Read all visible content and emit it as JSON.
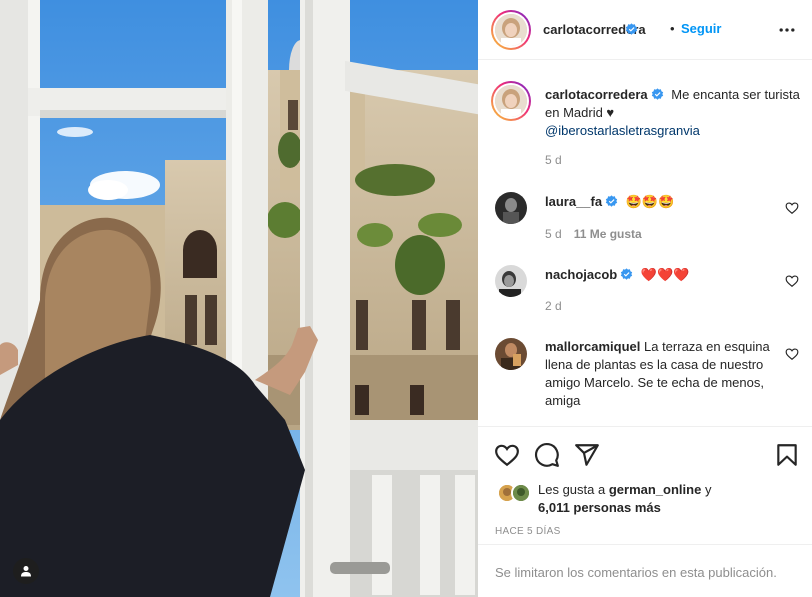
{
  "post": {
    "author": "carlotacorredera",
    "follow_label": "Seguir",
    "dot": "•"
  },
  "caption": {
    "username": "carlotacorredera",
    "text": "Me encanta ser turista en Madrid ♥",
    "mention": "@iberostarlasletrasgranvia",
    "time": "5 d"
  },
  "comments": [
    {
      "username": "laura__fa",
      "verified": true,
      "text": "🤩🤩🤩",
      "time": "5 d",
      "likes": "11 Me gusta"
    },
    {
      "username": "nachojacob",
      "verified": true,
      "text": "❤️❤️❤️",
      "time": "2 d"
    },
    {
      "username": "mallorcamiquel",
      "verified": false,
      "text": "La terraza en esquina llena de plantas es la casa de nuestro amigo Marcelo. Se te echa de menos, amiga"
    }
  ],
  "likes": {
    "prefix": "Les gusta a",
    "user": "german_online",
    "connector": "y",
    "count": "6,011 personas más"
  },
  "date": "HACE 5 DÍAS",
  "footer": "Se limitaron los comentarios en esta publicación.",
  "colors": {
    "accent": "#0095f6",
    "verified": "#3897f0",
    "text": "#262626",
    "muted": "#8e8e8e"
  },
  "icons": [
    "tag-user-icon",
    "more-options-icon",
    "verified-icon",
    "heart-icon",
    "comment-icon",
    "share-icon",
    "bookmark-icon"
  ]
}
